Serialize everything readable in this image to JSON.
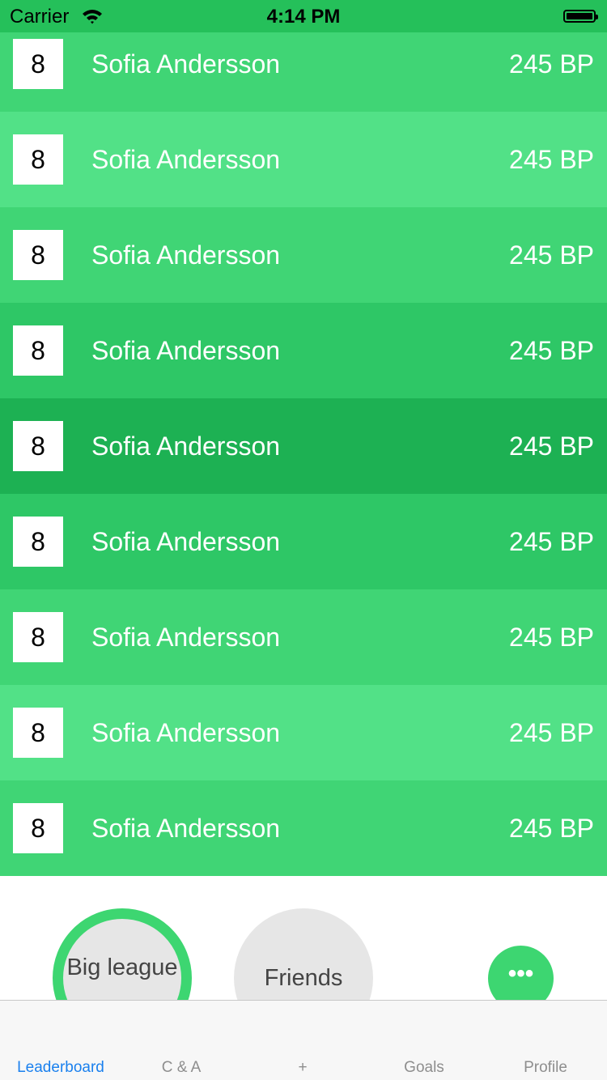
{
  "status_bar": {
    "carrier": "Carrier",
    "time": "4:14 PM"
  },
  "rows": [
    {
      "rank": "8",
      "name": "Sofia Andersson",
      "points": "245 BP",
      "color": "#40d575"
    },
    {
      "rank": "8",
      "name": "Sofia Andersson",
      "points": "245 BP",
      "color": "#52e187"
    },
    {
      "rank": "8",
      "name": "Sofia Andersson",
      "points": "245 BP",
      "color": "#40d575"
    },
    {
      "rank": "8",
      "name": "Sofia Andersson",
      "points": "245 BP",
      "color": "#2ec766"
    },
    {
      "rank": "8",
      "name": "Sofia Andersson",
      "points": "245 BP",
      "color": "#1db153"
    },
    {
      "rank": "8",
      "name": "Sofia Andersson",
      "points": "245 BP",
      "color": "#2ec766"
    },
    {
      "rank": "8",
      "name": "Sofia Andersson",
      "points": "245 BP",
      "color": "#40d575"
    },
    {
      "rank": "8",
      "name": "Sofia Andersson",
      "points": "245 BP",
      "color": "#52e187"
    },
    {
      "rank": "8",
      "name": "Sofia Andersson",
      "points": "245 BP",
      "color": "#40d575"
    }
  ],
  "filters": {
    "big_league": "Big league",
    "friends": "Friends",
    "more": "•••",
    "active_ring_color": "#3dd671"
  },
  "tabbar": {
    "leaderboard": "Leaderboard",
    "ca": "C & A",
    "plus": "+",
    "goals": "Goals",
    "profile": "Profile",
    "active_color": "#1a80ee"
  }
}
